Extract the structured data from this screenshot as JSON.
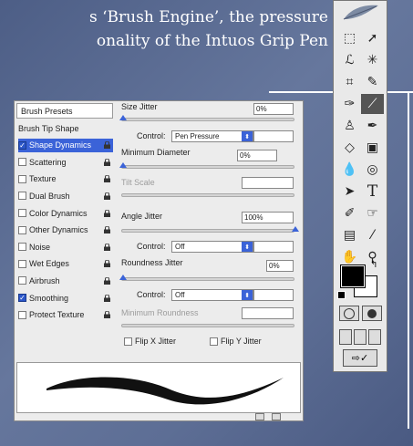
{
  "intro": {
    "line1": "s ‘Brush Engine’, the pressure",
    "line2": "onality of the Intuos Grip Pen"
  },
  "brushes": {
    "presets_tab": "Brush Presets",
    "options": [
      {
        "label": "Brush Tip Shape",
        "checkbox": false,
        "checked": false,
        "selected": false,
        "lock": false
      },
      {
        "label": "Shape Dynamics",
        "checkbox": true,
        "checked": true,
        "selected": true,
        "lock": true
      },
      {
        "label": "Scattering",
        "checkbox": true,
        "checked": false,
        "selected": false,
        "lock": true
      },
      {
        "label": "Texture",
        "checkbox": true,
        "checked": false,
        "selected": false,
        "lock": true
      },
      {
        "label": "Dual Brush",
        "checkbox": true,
        "checked": false,
        "selected": false,
        "lock": true
      },
      {
        "label": "Color Dynamics",
        "checkbox": true,
        "checked": false,
        "selected": false,
        "lock": true
      },
      {
        "label": "Other Dynamics",
        "checkbox": true,
        "checked": false,
        "selected": false,
        "lock": true
      },
      {
        "label": "Noise",
        "checkbox": true,
        "checked": false,
        "selected": false,
        "lock": true
      },
      {
        "label": "Wet Edges",
        "checkbox": true,
        "checked": false,
        "selected": false,
        "lock": true
      },
      {
        "label": "Airbrush",
        "checkbox": true,
        "checked": false,
        "selected": false,
        "lock": true
      },
      {
        "label": "Smoothing",
        "checkbox": true,
        "checked": true,
        "selected": false,
        "lock": true
      },
      {
        "label": "Protect Texture",
        "checkbox": true,
        "checked": false,
        "selected": false,
        "lock": true
      }
    ],
    "size_jitter": {
      "label": "Size Jitter",
      "value": "0%"
    },
    "size_control": {
      "label": "Control:",
      "value": "Pen Pressure"
    },
    "minimum_diameter": {
      "label": "Minimum Diameter",
      "value": "0%"
    },
    "tilt_scale": {
      "label": "Tilt Scale",
      "value": ""
    },
    "angle_jitter": {
      "label": "Angle Jitter",
      "value": "100%",
      "level": 1.0
    },
    "angle_control": {
      "label": "Control:",
      "value": "Off"
    },
    "roundness_jitter": {
      "label": "Roundness Jitter",
      "value": "0%"
    },
    "roundness_control": {
      "label": "Control:",
      "value": "Off"
    },
    "minimum_roundness": {
      "label": "Minimum Roundness",
      "value": ""
    },
    "flip_x": "Flip X Jitter",
    "flip_y": "Flip Y Jitter"
  },
  "colors": {
    "accent": "#3b63d8",
    "foreground": "#000000",
    "background": "#ffffff"
  },
  "tools": [
    "marquee-icon",
    "move-icon",
    "lasso-icon",
    "magic-wand-icon",
    "crop-icon",
    "slice-icon",
    "healing-brush-icon",
    "brush-icon",
    "clone-stamp-icon",
    "history-brush-icon",
    "eraser-icon",
    "gradient-icon",
    "blur-icon",
    "dodge-icon",
    "path-select-icon",
    "type-icon",
    "pen-icon",
    "shape-icon",
    "notes-icon",
    "eyedropper-icon",
    "hand-icon",
    "zoom-icon"
  ]
}
